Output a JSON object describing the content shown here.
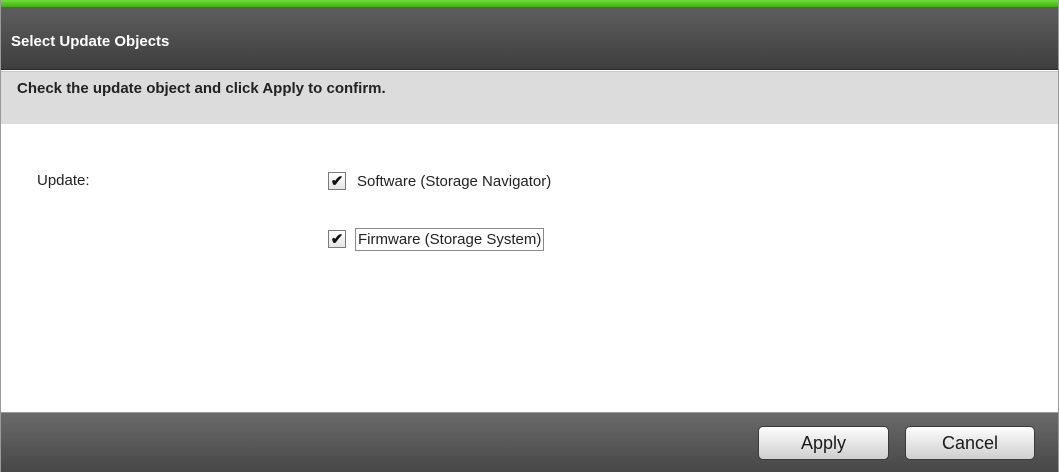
{
  "dialog": {
    "title": "Select Update Objects",
    "instruction": "Check the update object and click Apply to confirm.",
    "accent_color": "#4cc21e"
  },
  "form": {
    "update_label": "Update:",
    "options": [
      {
        "label": "Software (Storage Navigator)",
        "checked": true,
        "check_glyph": "✔"
      },
      {
        "label": "Firmware (Storage System)",
        "checked": true,
        "check_glyph": "✔"
      }
    ]
  },
  "footer": {
    "apply_label": "Apply",
    "cancel_label": "Cancel"
  }
}
